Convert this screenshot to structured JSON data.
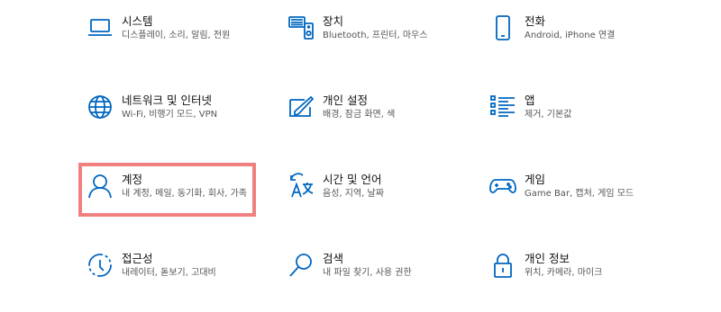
{
  "colors": {
    "accent": "#0067c0",
    "highlight": "#f08080"
  },
  "tiles": [
    {
      "title": "시스템",
      "desc": "디스플레이, 소리, 알림, 전원",
      "icon": "laptop-icon"
    },
    {
      "title": "장치",
      "desc": "Bluetooth, 프린터, 마우스",
      "icon": "devices-icon"
    },
    {
      "title": "전화",
      "desc": "Android, iPhone 연결",
      "icon": "phone-icon"
    },
    {
      "title": "네트워크 및 인터넷",
      "desc": "Wi-Fi, 비행기 모드, VPN",
      "icon": "globe-icon"
    },
    {
      "title": "개인 설정",
      "desc": "배경, 잠금 화면, 색",
      "icon": "personalization-icon"
    },
    {
      "title": "앱",
      "desc": "제거, 기본값",
      "icon": "apps-list-icon"
    },
    {
      "title": "계정",
      "desc": "내 계정, 메일, 동기화, 회사, 가족",
      "icon": "person-icon"
    },
    {
      "title": "시간 및 언어",
      "desc": "음성, 지역, 날짜",
      "icon": "time-language-icon"
    },
    {
      "title": "게임",
      "desc": "Game Bar, 캡처, 게임 모드",
      "icon": "gamepad-icon"
    },
    {
      "title": "접근성",
      "desc": "내레이터, 돋보기, 고대비",
      "icon": "accessibility-icon"
    },
    {
      "title": "검색",
      "desc": "내 파일 찾기, 사용 권한",
      "icon": "search-icon"
    },
    {
      "title": "개인 정보",
      "desc": "위치, 카메라, 마이크",
      "icon": "lock-icon"
    }
  ]
}
